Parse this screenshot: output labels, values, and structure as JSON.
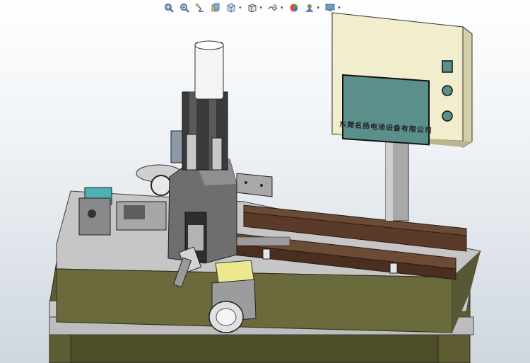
{
  "toolbar": {
    "buttons": [
      {
        "name": "zoom-to-fit",
        "icon": "zoom-fit-icon",
        "dropdown": false
      },
      {
        "name": "zoom-to-area",
        "icon": "zoom-area-icon",
        "dropdown": false
      },
      {
        "name": "previous-view",
        "icon": "previous-view-icon",
        "dropdown": false
      },
      {
        "name": "section-view",
        "icon": "section-view-icon",
        "dropdown": false
      },
      {
        "name": "dynamic-annotation",
        "icon": "view-orientation-icon",
        "dropdown": true
      },
      {
        "name": "display-style",
        "icon": "display-style-icon",
        "dropdown": true
      },
      {
        "name": "hide-show-items",
        "icon": "hide-show-icon",
        "dropdown": true
      },
      {
        "name": "edit-appearance",
        "icon": "appearance-icon",
        "dropdown": false
      },
      {
        "name": "apply-scene",
        "icon": "scene-icon",
        "dropdown": true
      },
      {
        "name": "view-settings",
        "icon": "monitor-icon",
        "dropdown": true
      }
    ]
  },
  "hmi": {
    "label": "东莞名扬电池设备有限公司"
  },
  "colors": {
    "frame_olive": "#5d5c33",
    "base_grey": "#c9c9c9",
    "panel_cream": "#f1edcd",
    "screen_teal": "#5b8f8c",
    "wood_brown": "#6b4a36",
    "accent_yellow": "#ece88f"
  }
}
